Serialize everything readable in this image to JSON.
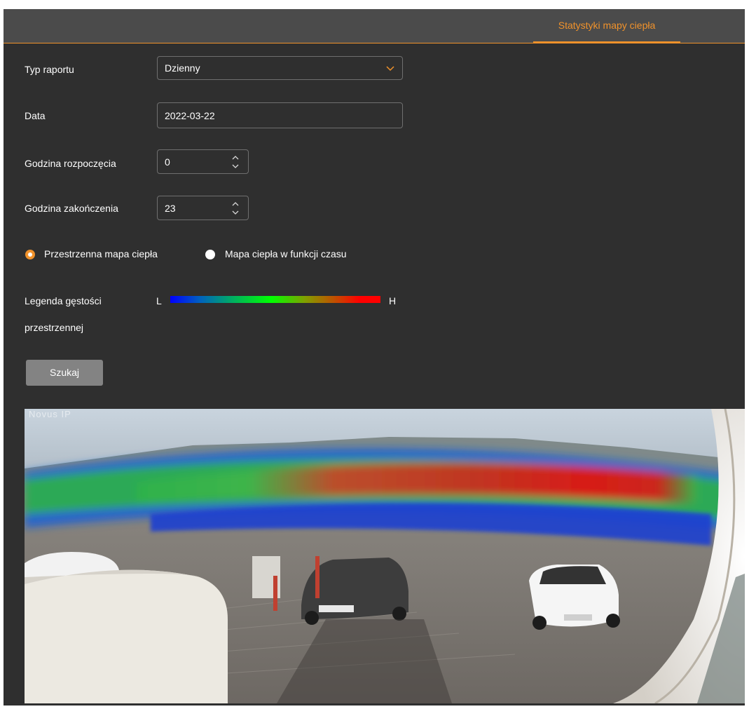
{
  "header": {
    "active_tab": "Statystyki mapy ciepła"
  },
  "form": {
    "report_type": {
      "label": "Typ raportu",
      "value": "Dzienny"
    },
    "date": {
      "label": "Data",
      "value": "2022-03-22"
    },
    "start_hour": {
      "label": "Godzina rozpoczęcia",
      "value": "0"
    },
    "end_hour": {
      "label": "Godzina zakończenia",
      "value": "23"
    },
    "mode": {
      "options": [
        {
          "label": "Przestrzenna mapa ciepła",
          "selected": true
        },
        {
          "label": "Mapa ciepła w funkcji czasu",
          "selected": false
        }
      ]
    },
    "legend": {
      "label_line1": "Legenda gęstości",
      "label_line2": "przestrzennej",
      "low": "L",
      "high": "H"
    },
    "search_button": "Szukaj"
  },
  "image": {
    "watermark": "Novus IP"
  },
  "colors": {
    "accent": "#f0922b",
    "background": "#2f2f2f",
    "tabbar": "#4b4b4b",
    "button": "#838383"
  }
}
